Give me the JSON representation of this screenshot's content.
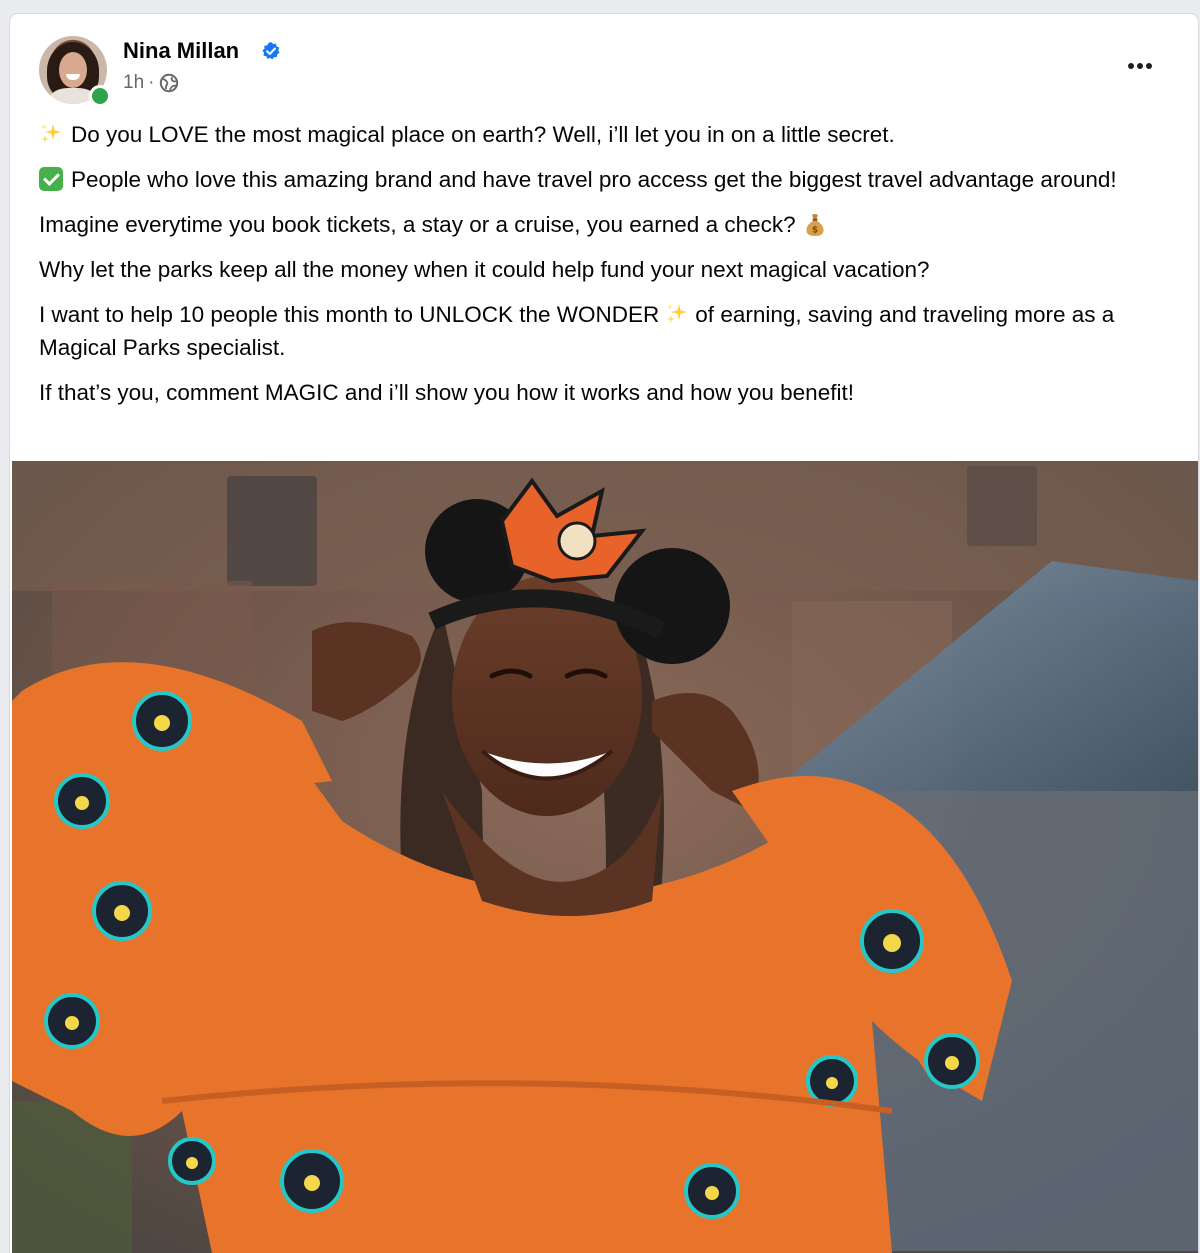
{
  "post": {
    "author": {
      "name": "Nina Millan",
      "verified": true,
      "online": true
    },
    "time": "1h",
    "separator": "·",
    "audience_icon": "globe-icon",
    "more_icon": "more-options-icon",
    "paragraphs": {
      "p1": "Do you LOVE the most magical place on earth? Well, i’ll let you in on a little secret.",
      "p2": "People who love this amazing brand and have travel pro access get the biggest travel advantage around!",
      "p3": "Imagine everytime you book tickets, a stay or a cruise, you earned a check?",
      "p4": "Why let the parks keep all the money when it could help fund your next magical vacation?",
      "p5a": "I want to help 10 people this month to UNLOCK the WONDER",
      "p5b": "of earning, saving and traveling more as a Magical Parks specialist.",
      "p6": "If that’s you, comment MAGIC and i’ll show you how it works and how you benefit!"
    },
    "emojis": {
      "p1": "sparkles-icon",
      "p2": "check-mark-button-icon",
      "p3": "money-bag-icon",
      "p5": "sparkles-icon"
    }
  },
  "colors": {
    "verified_blue": "#1877f2",
    "online_green": "#31a24c",
    "sweater_orange": "#e8742c"
  }
}
